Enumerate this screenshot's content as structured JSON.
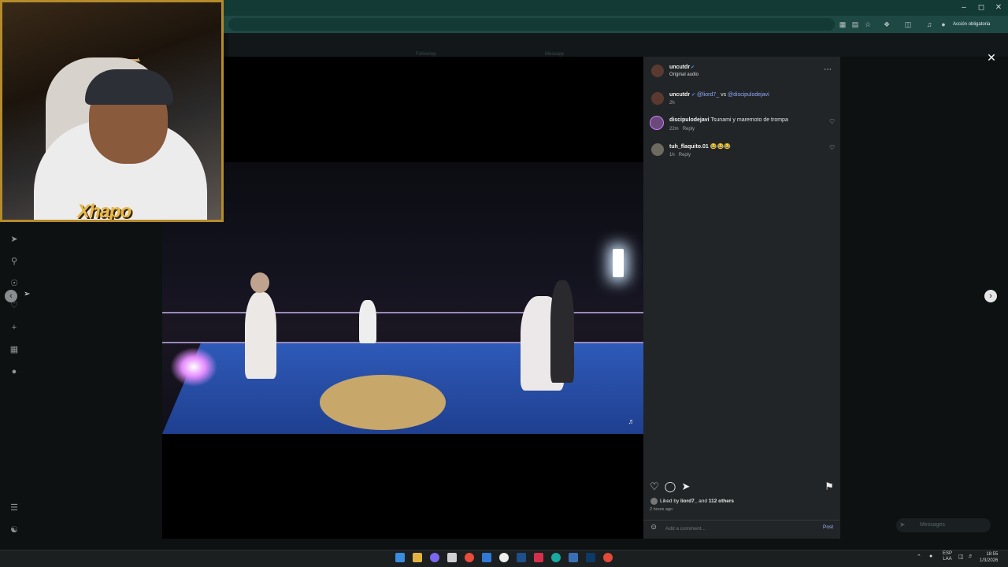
{
  "browser": {
    "action_button": "Acción obligatoria",
    "dim_tabs": [
      "Following",
      "Message"
    ]
  },
  "webcam": {
    "overlay_text": "Xhapo"
  },
  "post": {
    "author": "uncutdr",
    "audio": "Original audio",
    "caption": {
      "user": "uncutdr",
      "mention1": "@liord7_",
      "vs": "vs",
      "mention2": "@discipulodejavi",
      "time": "2h"
    },
    "comments": [
      {
        "user": "discipulodejavi",
        "text": "Tsunami y maremoto de trompa",
        "time": "22m",
        "reply": "Reply"
      },
      {
        "user": "tuh_flaquito.01",
        "text": "😂😂😂",
        "time": "1h",
        "reply": "Reply"
      }
    ],
    "likes": {
      "prefix": "Liked by",
      "user": "liord7_",
      "and": "and",
      "others": "112 others"
    },
    "posted": "2 hours ago",
    "add_comment_placeholder": "Add a comment...",
    "post_label": "Post"
  },
  "messages_label": "Messages",
  "taskbar": {
    "lang": "ESP",
    "layout": "LAA",
    "time": "18:55",
    "date": "1/3/2026"
  },
  "colors": {
    "accent": "#1e4844",
    "frame": "#b58b2c",
    "link": "#8fa9ff"
  }
}
